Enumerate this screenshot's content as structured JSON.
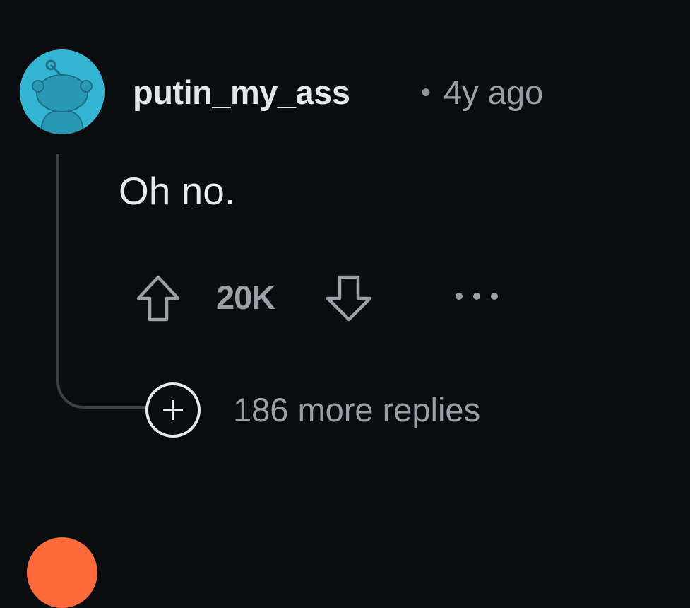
{
  "comment": {
    "username": "putin_my_ass",
    "separator": "•",
    "timestamp": "4y ago",
    "body": "Oh no.",
    "score": "20K",
    "more_replies_label": "186 more replies"
  },
  "icons": {
    "avatar": "snoo-avatar-icon",
    "upvote": "upvote-arrow-icon",
    "downvote": "downvote-arrow-icon",
    "more": "more-options-icon",
    "expand": "plus-circle-icon"
  },
  "colors": {
    "background": "#0b0c0f",
    "avatar_bg": "#33b5d3",
    "next_avatar_bg": "#ff6a3d",
    "muted_text": "#9aa0a4",
    "primary_text": "#e8eaec"
  }
}
